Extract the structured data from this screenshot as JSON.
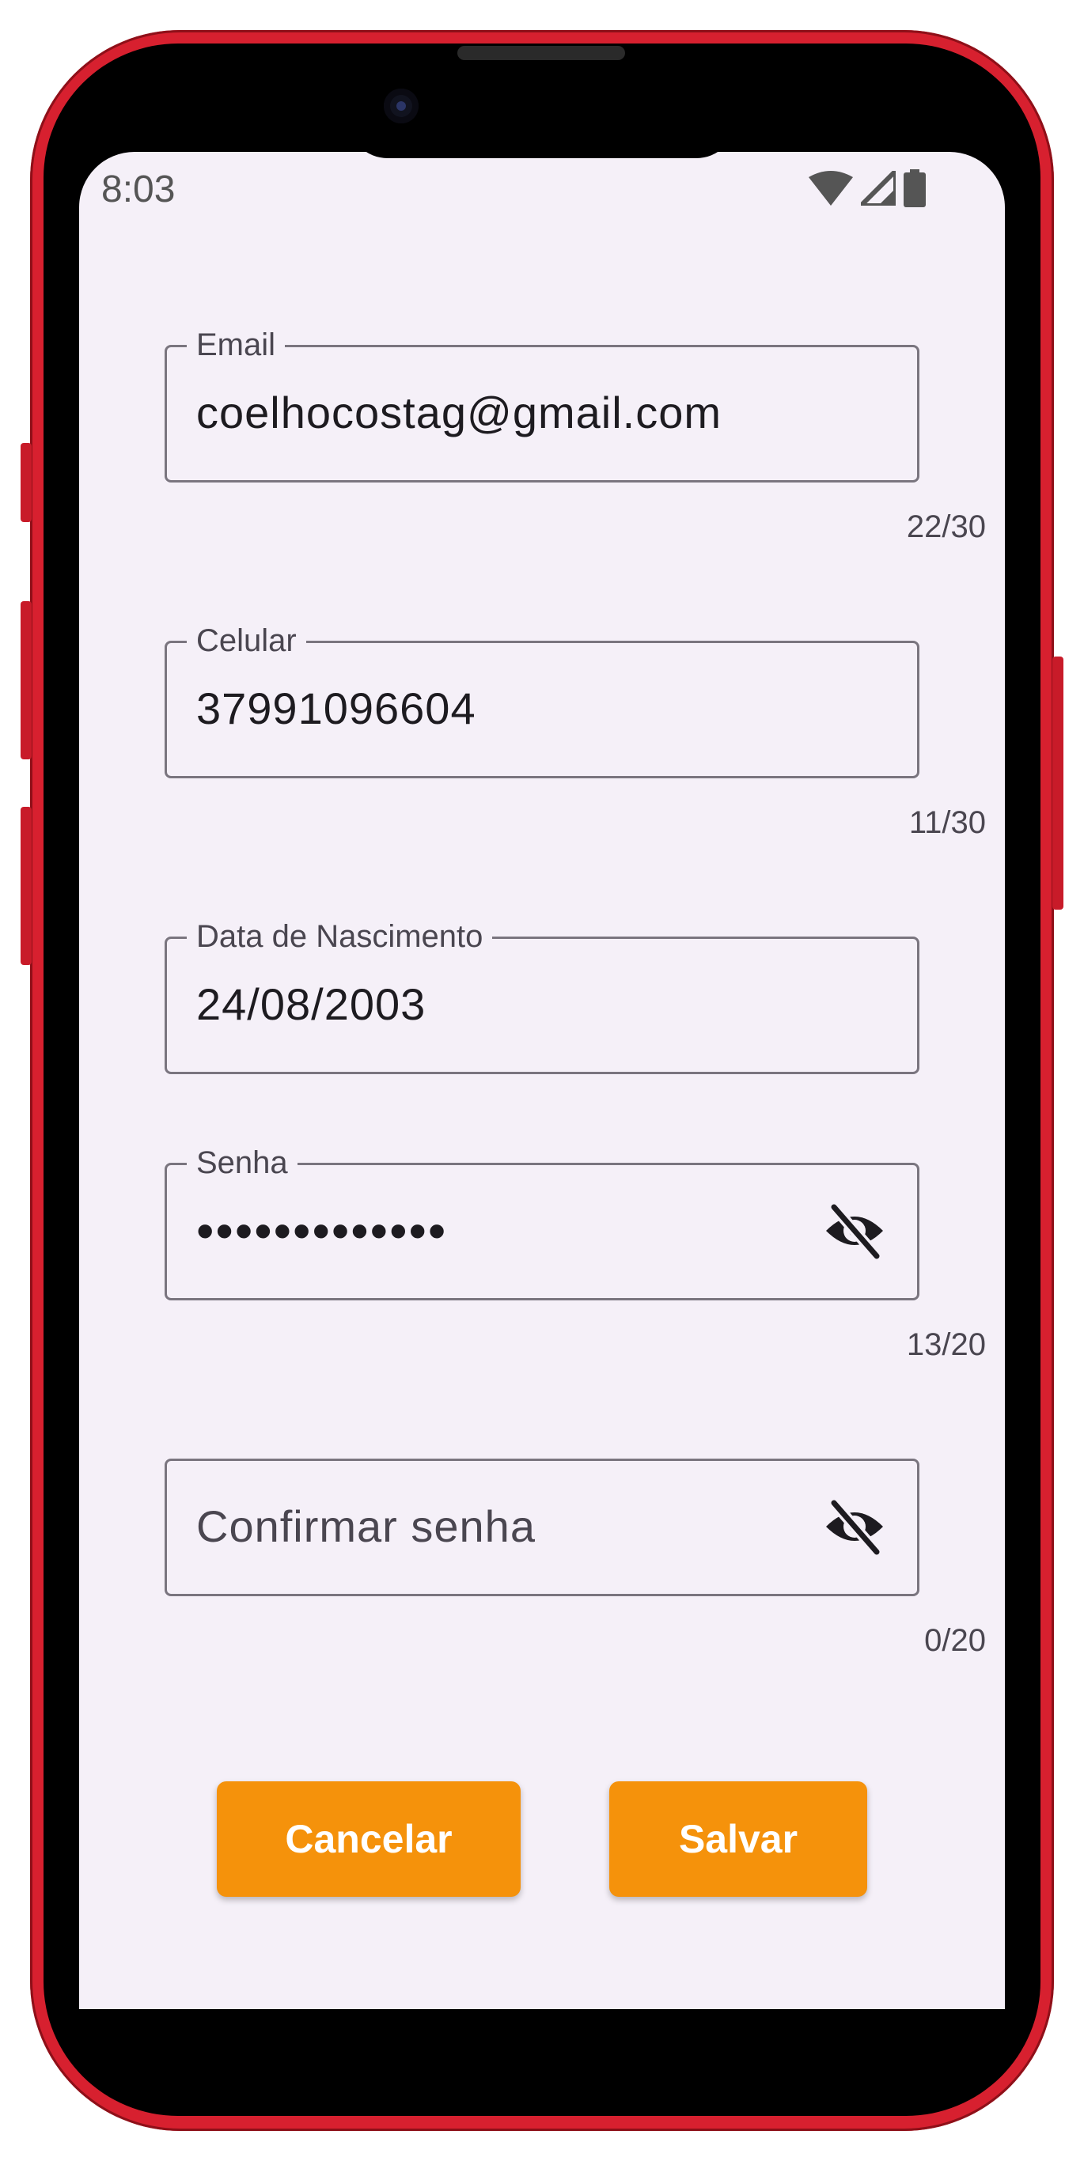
{
  "status_bar": {
    "time": "8:03",
    "icons": [
      "wifi-icon",
      "signal-icon",
      "battery-icon"
    ]
  },
  "form": {
    "email": {
      "label": "Email",
      "value": "coelhocostag@gmail.com",
      "counter": "22/30"
    },
    "celular": {
      "label": "Celular",
      "value": "37991096604",
      "counter": "11/30"
    },
    "nascimento": {
      "label": "Data de Nascimento",
      "value": "24/08/2003"
    },
    "senha": {
      "label": "Senha",
      "value": "•••••••••••••",
      "counter": "13/20",
      "icon": "eye-off-icon"
    },
    "confirmar": {
      "placeholder": "Confirmar senha",
      "counter": "0/20",
      "icon": "eye-off-icon"
    }
  },
  "buttons": {
    "cancel_label": "Cancelar",
    "save_label": "Salvar"
  },
  "colors": {
    "frame": "#d7202f",
    "screen_bg": "#f5f0f8",
    "button": "#f5920b",
    "outline": "#7a757f"
  }
}
